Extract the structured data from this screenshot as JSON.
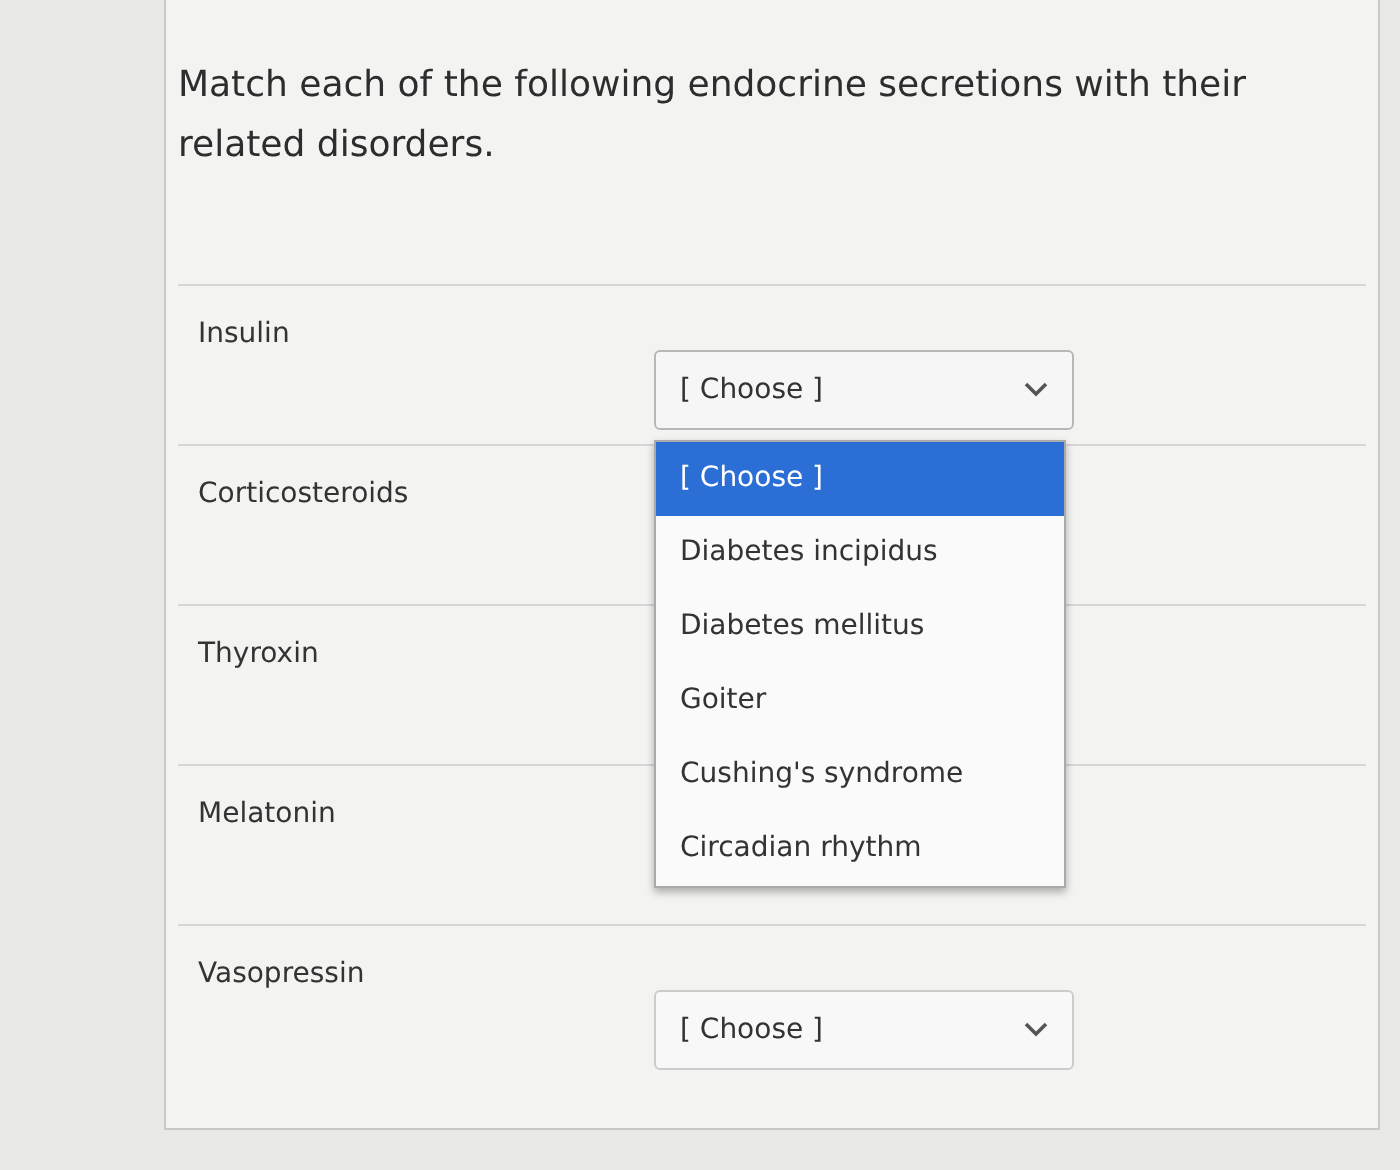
{
  "question": "Match each of the following endocrine secretions with their related disorders.",
  "rows": [
    {
      "prompt": "Insulin",
      "select": {
        "value": "[ Choose ]",
        "expanded": true,
        "options": [
          {
            "label": "[ Choose ]",
            "selected": true
          },
          {
            "label": "Diabetes incipidus",
            "selected": false
          },
          {
            "label": "Diabetes mellitus",
            "selected": false
          },
          {
            "label": "Goiter",
            "selected": false
          },
          {
            "label": "Cushing's syndrome",
            "selected": false
          },
          {
            "label": "Circadian rhythm",
            "selected": false
          }
        ]
      }
    },
    {
      "prompt": "Corticosteroids"
    },
    {
      "prompt": "Thyroxin"
    },
    {
      "prompt": "Melatonin"
    },
    {
      "prompt": "Vasopressin",
      "select": {
        "value": "[ Choose ]",
        "expanded": false
      }
    }
  ]
}
